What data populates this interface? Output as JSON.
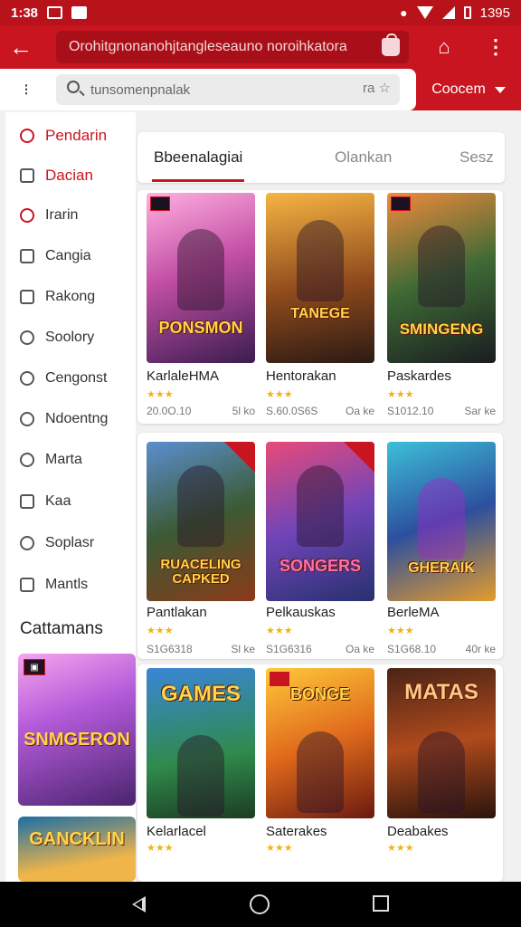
{
  "status_bar": {
    "time": "1:38",
    "battery": "1395"
  },
  "app_bar": {
    "url": "Orohitgnonanohjtangleseauno noroihkatora"
  },
  "search": {
    "placeholder": "tunsomenpnalak",
    "tools_label": "ra ☆",
    "category_label": "Coocem"
  },
  "sidebar": {
    "items": [
      {
        "label": "Pendarin",
        "icon": "search-icon"
      },
      {
        "label": "Dacian",
        "icon": "document-icon"
      },
      {
        "label": "Irarin",
        "icon": "chat-icon"
      },
      {
        "label": "Cangia",
        "icon": "mail-icon"
      },
      {
        "label": "Rakong",
        "icon": "checklist-icon"
      },
      {
        "label": "Soolory",
        "icon": "clock-icon"
      },
      {
        "label": "Cengonst",
        "icon": "refresh-icon"
      },
      {
        "label": "Ndoentng",
        "icon": "location-icon"
      },
      {
        "label": "Marta",
        "icon": "timer-icon"
      },
      {
        "label": "Kaa",
        "icon": "square-icon"
      },
      {
        "label": "Soplasr",
        "icon": "circle-icon"
      },
      {
        "label": "Mantls",
        "icon": "list-icon"
      }
    ],
    "section_heading": "Cattamans",
    "thumbs": [
      {
        "title": "SNMGERON"
      },
      {
        "title": "GANCKLIN"
      }
    ]
  },
  "tabs": [
    "Bbeenalagiai",
    "Olankan",
    "Sesz"
  ],
  "games": [
    {
      "cover_title": "PONSMON",
      "name": "KarlaleHMA",
      "rating": "★★★",
      "price": "20.0O.10",
      "size": "5l ko"
    },
    {
      "cover_title": "TANEGE",
      "name": "Hentorakan",
      "rating": "★★★",
      "price": "S.60.0S6S",
      "size": "Oa ke"
    },
    {
      "cover_title": "SMINGENG",
      "name": "Paskardes",
      "rating": "★★★",
      "price": "S1012.10",
      "size": "Sar ke"
    },
    {
      "cover_title": "RUACELING CAPKED",
      "name": "Pantlakan",
      "rating": "★★★",
      "price": "S1G6318",
      "size": "Sl ke"
    },
    {
      "cover_title": "SONGERS",
      "name": "Pelkauskas",
      "rating": "★★★",
      "price": "S1G6316",
      "size": "Oa ke"
    },
    {
      "cover_title": "GHERAIK",
      "name": "BerleMA",
      "rating": "★★★",
      "price": "S1G68.10",
      "size": "40r ke"
    },
    {
      "cover_title": "GAMES",
      "name": "Kelarlacel",
      "rating": "★★★",
      "price": "",
      "size": ""
    },
    {
      "cover_title": "BONGE",
      "name": "Saterakes",
      "rating": "★★★",
      "price": "",
      "size": ""
    },
    {
      "cover_title": "MATAS",
      "name": "Deabakes",
      "rating": "★★★",
      "price": "",
      "size": ""
    }
  ]
}
